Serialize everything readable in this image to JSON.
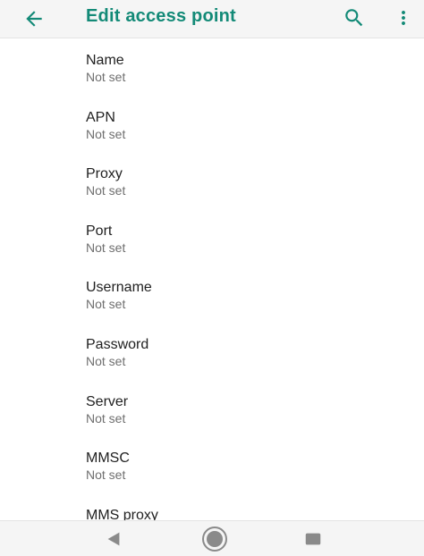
{
  "app_bar": {
    "title": "Edit access point",
    "back_icon": "arrow-back-icon",
    "search_icon": "search-icon",
    "more_icon": "more-vert-icon",
    "accent_color": "#138a77"
  },
  "preferences": [
    {
      "title": "Name",
      "summary": "Not set"
    },
    {
      "title": "APN",
      "summary": "Not set"
    },
    {
      "title": "Proxy",
      "summary": "Not set"
    },
    {
      "title": "Port",
      "summary": "Not set"
    },
    {
      "title": "Username",
      "summary": "Not set"
    },
    {
      "title": "Password",
      "summary": "Not set"
    },
    {
      "title": "Server",
      "summary": "Not set"
    },
    {
      "title": "MMSC",
      "summary": "Not set"
    },
    {
      "title": "MMS proxy",
      "summary": ""
    }
  ],
  "nav_bar": {
    "back_icon": "nav-back-icon",
    "home_icon": "nav-home-icon",
    "recents_icon": "nav-recents-icon"
  }
}
